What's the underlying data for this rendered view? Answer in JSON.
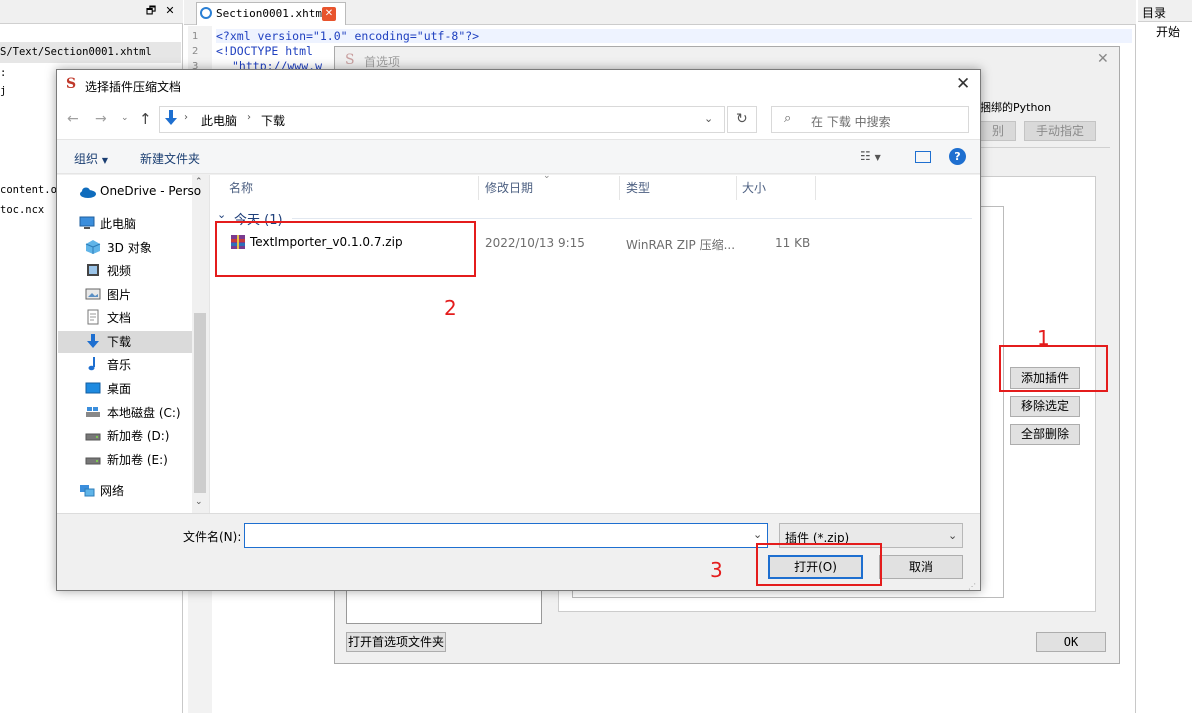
{
  "left_panel": {
    "header_buttons": [
      "🗗",
      "✕"
    ],
    "items": [
      "S/Text/Section0001.xhtml",
      "content.o",
      "toc.ncx"
    ],
    "prefixes": [
      ":",
      "j"
    ]
  },
  "editor": {
    "tab_title": "Section0001.xhtml",
    "lines": [
      {
        "num": "1",
        "text": "<?xml version=\"1.0\" encoding=\"utf-8\"?>"
      },
      {
        "num": "2",
        "text": "<!DOCTYPE html"
      },
      {
        "num": "3",
        "text": "\"http://www.w"
      }
    ]
  },
  "right_panel": {
    "title": "目录",
    "item": "开始"
  },
  "preferences": {
    "title": "首选项",
    "partial_text": "捆绑的Python",
    "btn_partial": "别",
    "btn_manual": "手动指定",
    "btn_add": "添加插件",
    "btn_remove": "移除选定",
    "btn_delete_all": "全部删除",
    "btn_open_folder": "打开首选项文件夹",
    "btn_ok": "OK"
  },
  "file_dialog": {
    "title": "选择插件压缩文档",
    "breadcrumb": [
      "此电脑",
      "下载"
    ],
    "search_placeholder": "在 下载 中搜索",
    "toolbar": {
      "organize": "组织",
      "new_folder": "新建文件夹"
    },
    "nav": [
      {
        "label": "OneDrive - Perso",
        "icon": "onedrive-icon"
      },
      {
        "label": "此电脑",
        "icon": "computer-icon"
      },
      {
        "label": "3D 对象",
        "icon": "3d-objects-icon"
      },
      {
        "label": "视频",
        "icon": "video-icon"
      },
      {
        "label": "图片",
        "icon": "pictures-icon"
      },
      {
        "label": "文档",
        "icon": "documents-icon"
      },
      {
        "label": "下载",
        "icon": "download-icon"
      },
      {
        "label": "音乐",
        "icon": "music-icon"
      },
      {
        "label": "桌面",
        "icon": "desktop-icon"
      },
      {
        "label": "本地磁盘 (C:)",
        "icon": "drive-icon"
      },
      {
        "label": "新加卷 (D:)",
        "icon": "drive-icon"
      },
      {
        "label": "新加卷 (E:)",
        "icon": "drive-icon"
      },
      {
        "label": "网络",
        "icon": "network-icon"
      }
    ],
    "columns": [
      "名称",
      "修改日期",
      "类型",
      "大小"
    ],
    "group_label": "今天 (1)",
    "file": {
      "name": "TextImporter_v0.1.0.7.zip",
      "date": "2022/10/13 9:15",
      "type": "WinRAR ZIP 压缩...",
      "size": "11 KB"
    },
    "filename_label": "文件名(N):",
    "filename_value": "",
    "filter": "插件 (*.zip)",
    "open_button": "打开(O)",
    "cancel_button": "取消"
  },
  "annotations": [
    "1",
    "2",
    "3"
  ],
  "colors": {
    "annotation_red": "#e41c1c",
    "accent_blue": "#1e6fd0",
    "selected_nav": "#cce8ff"
  }
}
